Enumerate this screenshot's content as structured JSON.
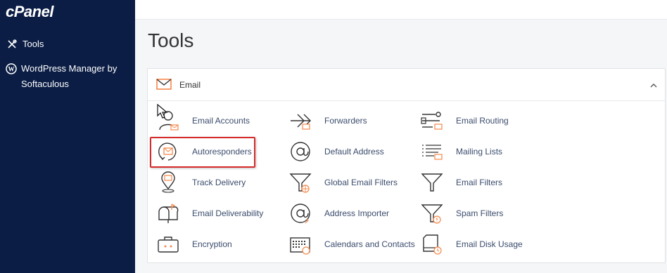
{
  "sidebar": {
    "logo": "cPanel",
    "items": [
      {
        "label": "Tools",
        "icon": "tools-icon"
      },
      {
        "label": "WordPress Manager by Softaculous",
        "icon": "wordpress-icon"
      }
    ]
  },
  "page": {
    "title": "Tools"
  },
  "section": {
    "title": "Email",
    "icon": "envelope-icon"
  },
  "tools": [
    {
      "label": "Email Accounts",
      "icon": "email-accounts-icon"
    },
    {
      "label": "Forwarders",
      "icon": "forwarders-icon"
    },
    {
      "label": "Email Routing",
      "icon": "email-routing-icon"
    },
    {
      "label": "Autoresponders",
      "icon": "autoresponders-icon"
    },
    {
      "label": "Default Address",
      "icon": "at-sign-icon"
    },
    {
      "label": "Mailing Lists",
      "icon": "mailing-lists-icon"
    },
    {
      "label": "Track Delivery",
      "icon": "location-pin-icon"
    },
    {
      "label": "Global Email Filters",
      "icon": "global-filter-icon"
    },
    {
      "label": "Email Filters",
      "icon": "filter-icon"
    },
    {
      "label": "Email Deliverability",
      "icon": "mailbox-icon"
    },
    {
      "label": "Address Importer",
      "icon": "at-import-icon"
    },
    {
      "label": "Spam Filters",
      "icon": "spam-filter-icon"
    },
    {
      "label": "Encryption",
      "icon": "briefcase-lock-icon"
    },
    {
      "label": "Calendars and Contacts",
      "icon": "calendar-icon"
    },
    {
      "label": "Email Disk Usage",
      "icon": "disk-usage-icon"
    }
  ],
  "colors": {
    "sidebar": "#0b1d45",
    "accent": "#f5884b",
    "highlight": "#d52b2b",
    "link": "#3b4c6d"
  }
}
